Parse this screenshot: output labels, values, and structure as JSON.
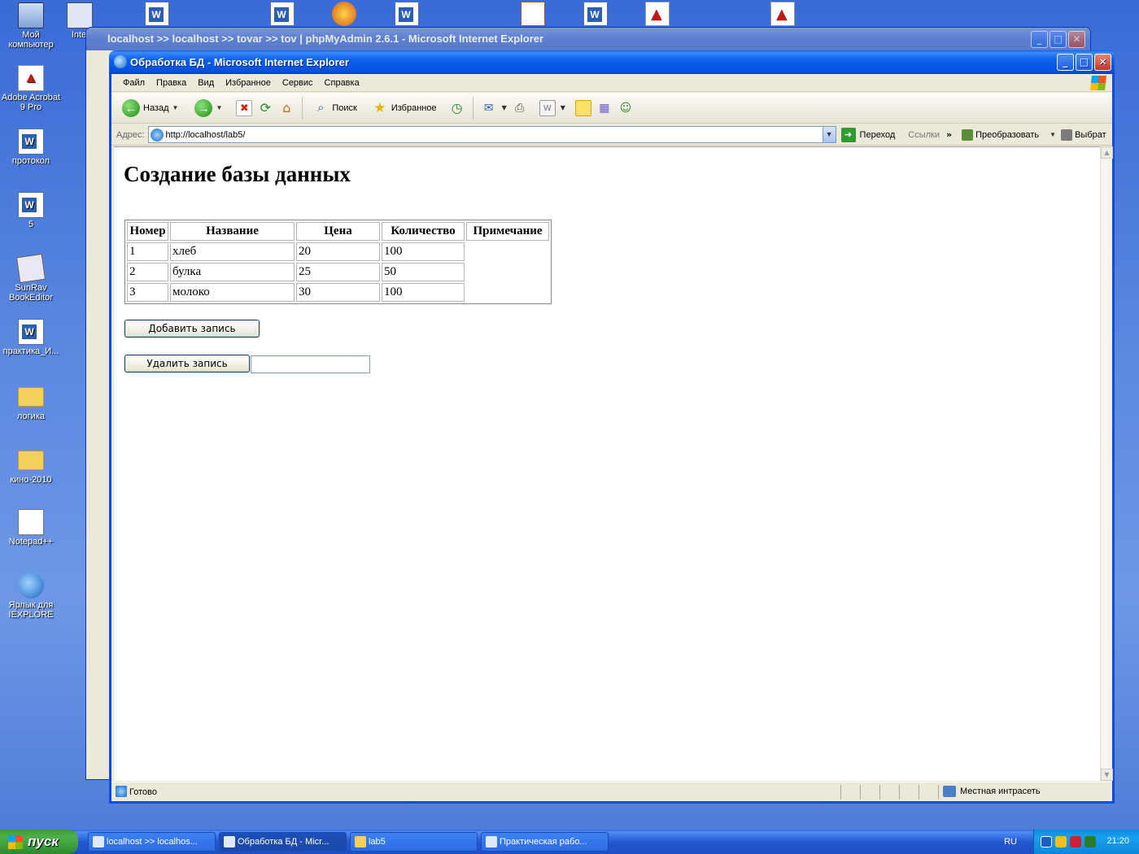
{
  "desktop": {
    "icons": [
      {
        "label": "Мой компьютер"
      },
      {
        "label": "Adobe Acrobat 9 Pro"
      },
      {
        "label": "протокол"
      },
      {
        "label": "5"
      },
      {
        "label": "SunRav BookEditor"
      },
      {
        "label": "практика_И..."
      },
      {
        "label": "логика"
      },
      {
        "label": "кино-2010"
      },
      {
        "label": "Notepad++"
      },
      {
        "label": "Ярлык для IEXPLORE"
      }
    ],
    "partial_icon_label": "Inte"
  },
  "background_window": {
    "title": "localhost >> localhost >> tovar >> tov | phpMyAdmin 2.6.1 - Microsoft Internet Explorer"
  },
  "window": {
    "title": "Обработка БД - Microsoft Internet Explorer",
    "menu": [
      "Файл",
      "Правка",
      "Вид",
      "Избранное",
      "Сервис",
      "Справка"
    ],
    "toolbar": {
      "back": "Назад",
      "search": "Поиск",
      "favorites": "Избранное"
    },
    "address": {
      "label": "Адрес:",
      "url": "http://localhost/lab5/",
      "go": "Переход",
      "links": "Ссылки",
      "convert": "Преобразовать",
      "select": "Выбрат"
    },
    "status": {
      "text": "Готово",
      "zone": "Местная интрасеть"
    }
  },
  "page": {
    "title": "Создание базы данных",
    "table": {
      "headers": [
        "Номер",
        "Название",
        "Цена",
        "Количество",
        "Примечание"
      ],
      "rows": [
        [
          "1",
          "хлеб",
          "20",
          "100"
        ],
        [
          "2",
          "булка",
          "25",
          "50"
        ],
        [
          "3",
          "молоко",
          "30",
          "100"
        ]
      ]
    },
    "add_button": "Добавить запись",
    "delete_button": "Удалить запись",
    "delete_input": ""
  },
  "taskbar": {
    "start": "пуск",
    "tasks": [
      "localhost >> localhos...",
      "Обработка БД - Micr...",
      "lab5",
      "Практическая рабо..."
    ],
    "lang": "RU",
    "clock": "21:20"
  }
}
